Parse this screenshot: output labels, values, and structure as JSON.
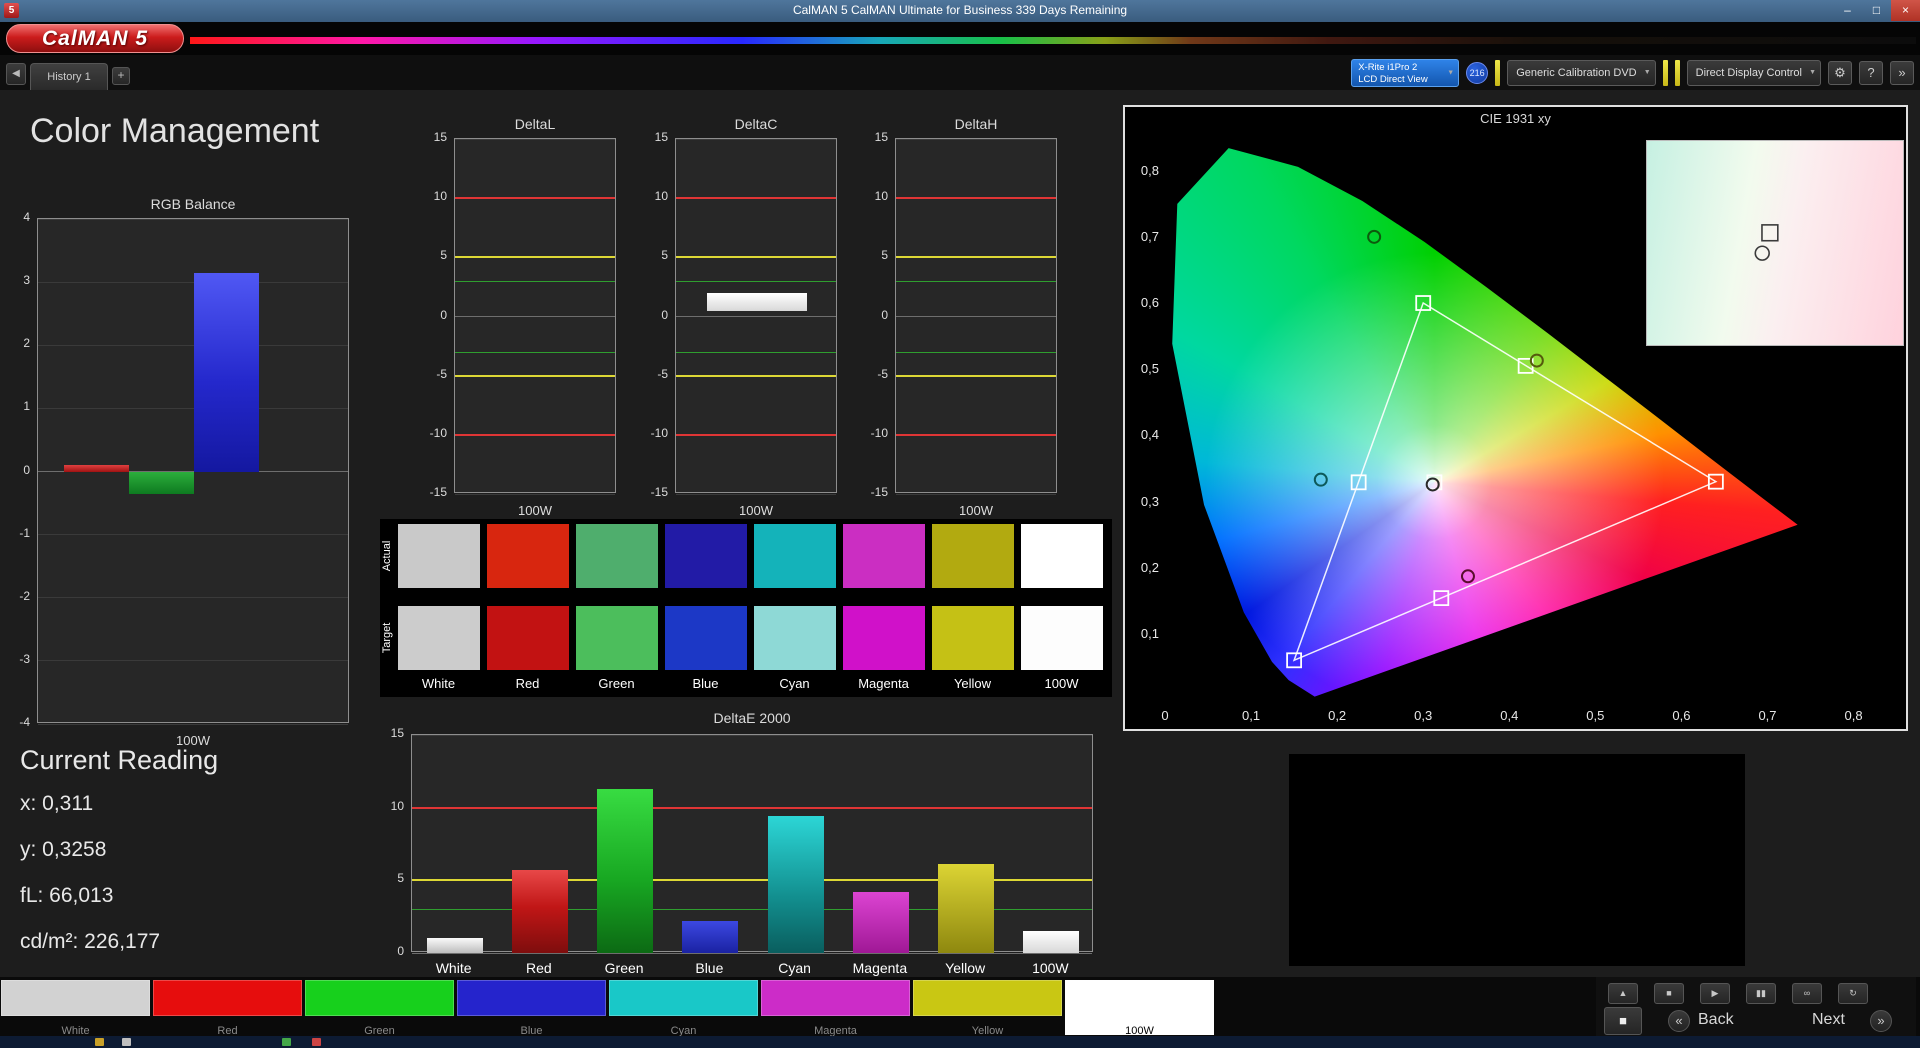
{
  "window": {
    "title": "CalMAN 5 CalMAN Ultimate for Business 339 Days Remaining",
    "app_icon": "5",
    "minimize": "–",
    "maximize": "□",
    "close": "×"
  },
  "branding": {
    "logo": "CalMAN 5"
  },
  "toolbar": {
    "nav_back": "◀",
    "history_tab": "History 1",
    "add_tab": "+",
    "meter_line1": "X-Rite i1Pro 2",
    "meter_line2": "LCD Direct View",
    "badge": "216",
    "source_dropdown": "Generic Calibration DVD",
    "display_dropdown": "Direct Display Control",
    "gear_icon": "⚙",
    "help_icon": "?",
    "expand_icon": "»",
    "caret": "▼"
  },
  "page_title": "Color Management",
  "current_reading": {
    "title": "Current Reading",
    "x": "x: 0,311",
    "y": "y: 0,3258",
    "fl": "fL: 66,013",
    "cd": "cd/m²: 226,177"
  },
  "swatch_grid": {
    "row_labels": [
      "Actual",
      "Target"
    ],
    "columns": [
      "White",
      "Red",
      "Green",
      "Blue",
      "Cyan",
      "Magenta",
      "Yellow",
      "100W"
    ],
    "actual_colors": [
      "#c9c9c9",
      "#d8260f",
      "#4fae6d",
      "#221ba6",
      "#14b3ba",
      "#cb2ec2",
      "#b2aa10",
      "#ffffff"
    ],
    "target_colors": [
      "#cccccc",
      "#c21212",
      "#4cbe5c",
      "#1c38c6",
      "#8ed9d6",
      "#d011c9",
      "#c5c115",
      "#fdfdfd"
    ]
  },
  "chart_data": [
    {
      "type": "bar",
      "title": "RGB Balance",
      "xlabel": "100W",
      "ylim": [
        -4,
        4
      ],
      "ticks": [
        4,
        3,
        2,
        1,
        0,
        -1,
        -2,
        -3,
        -4
      ],
      "categories": [
        "Red",
        "Green",
        "Blue"
      ],
      "values": [
        0.1,
        -0.35,
        3.15
      ],
      "bar_colors": [
        "rgb_red",
        "rgb_green",
        "rgb_blue"
      ]
    },
    {
      "type": "bar",
      "title": "DeltaL",
      "xlabel": "100W",
      "ylim": [
        -15,
        15
      ],
      "ticks": [
        15,
        10,
        5,
        0,
        -5,
        -10,
        -15
      ],
      "ref_lines": [
        {
          "y": 10,
          "color": "#e03535",
          "w": 2
        },
        {
          "y": -10,
          "color": "#e03535",
          "w": 2
        },
        {
          "y": 5,
          "color": "#ddd835",
          "w": 2
        },
        {
          "y": -5,
          "color": "#ddd835",
          "w": 2
        },
        {
          "y": 3,
          "color": "#2f9e2f",
          "w": 1
        },
        {
          "y": -3,
          "color": "#2f9e2f",
          "w": 1
        }
      ],
      "categories": [
        "100W"
      ],
      "values": [],
      "bar_colors": []
    },
    {
      "type": "bar",
      "title": "DeltaC",
      "xlabel": "100W",
      "ylim": [
        -15,
        15
      ],
      "ticks": [
        15,
        10,
        5,
        0,
        -5,
        -10,
        -15
      ],
      "ref_lines": [
        {
          "y": 10,
          "color": "#e03535",
          "w": 2
        },
        {
          "y": -10,
          "color": "#e03535",
          "w": 2
        },
        {
          "y": 5,
          "color": "#ddd835",
          "w": 2
        },
        {
          "y": -5,
          "color": "#ddd835",
          "w": 2
        },
        {
          "y": 3,
          "color": "#2f9e2f",
          "w": 1
        },
        {
          "y": -3,
          "color": "#2f9e2f",
          "w": 1
        }
      ],
      "categories": [
        "100W"
      ],
      "values": [
        1.95
      ],
      "bases": [
        0.45
      ],
      "bar_colors": [
        "plain_white"
      ]
    },
    {
      "type": "bar",
      "title": "DeltaH",
      "xlabel": "100W",
      "ylim": [
        -15,
        15
      ],
      "ticks": [
        15,
        10,
        5,
        0,
        -5,
        -10,
        -15
      ],
      "ref_lines": [
        {
          "y": 10,
          "color": "#e03535",
          "w": 2
        },
        {
          "y": -10,
          "color": "#e03535",
          "w": 2
        },
        {
          "y": 5,
          "color": "#ddd835",
          "w": 2
        },
        {
          "y": -5,
          "color": "#ddd835",
          "w": 2
        },
        {
          "y": 3,
          "color": "#2f9e2f",
          "w": 1
        },
        {
          "y": -3,
          "color": "#2f9e2f",
          "w": 1
        }
      ],
      "categories": [
        "100W"
      ],
      "values": [],
      "bar_colors": []
    },
    {
      "type": "bar",
      "title": "DeltaE 2000",
      "xlabel": "",
      "ylim": [
        0,
        15
      ],
      "ticks": [
        15,
        10,
        5,
        0
      ],
      "ref_lines": [
        {
          "y": 10,
          "color": "#e03535",
          "w": 2
        },
        {
          "y": 5,
          "color": "#ddd835",
          "w": 2
        },
        {
          "y": 3,
          "color": "#2f9e2f",
          "w": 1
        }
      ],
      "categories": [
        "White",
        "Red",
        "Green",
        "Blue",
        "Cyan",
        "Magenta",
        "Yellow",
        "100W"
      ],
      "values": [
        1.0,
        5.7,
        11.3,
        2.2,
        9.4,
        4.2,
        6.1,
        1.5
      ],
      "bar_colors": [
        "white",
        "red",
        "green",
        "blue",
        "cyan",
        "magenta",
        "yellow",
        "plain_white"
      ]
    },
    {
      "type": "scatter",
      "title": "CIE 1931 xy",
      "xlim": [
        0,
        0.84
      ],
      "ylim": [
        0,
        0.86
      ],
      "x_ticks": {
        "values": [
          0,
          0.1,
          0.2,
          0.3,
          0.4,
          0.5,
          0.6,
          0.7,
          0.8
        ],
        "labels": [
          "0",
          "0,1",
          "0,2",
          "0,3",
          "0,4",
          "0,5",
          "0,6",
          "0,7",
          "0,8"
        ]
      },
      "y_ticks": {
        "values": [
          0.1,
          0.2,
          0.3,
          0.4,
          0.5,
          0.6,
          0.7,
          0.8
        ],
        "labels": [
          "0,1",
          "0,2",
          "0,3",
          "0,4",
          "0,5",
          "0,6",
          "0,7",
          "0,8"
        ]
      },
      "gamut_triangle": [
        [
          0.64,
          0.33
        ],
        [
          0.3,
          0.6
        ],
        [
          0.15,
          0.06
        ]
      ],
      "targets": [
        [
          0.313,
          0.329
        ],
        [
          0.64,
          0.33
        ],
        [
          0.3,
          0.6
        ],
        [
          0.15,
          0.06
        ],
        [
          0.225,
          0.329
        ],
        [
          0.321,
          0.154
        ],
        [
          0.419,
          0.505
        ]
      ],
      "measurements": [
        {
          "x": 0.311,
          "y": 0.3258,
          "color": "#2a2a2a"
        },
        {
          "x": 0.243,
          "y": 0.7,
          "color": "#0d5a0d"
        },
        {
          "x": 0.181,
          "y": 0.333,
          "color": "#0d5a5a"
        },
        {
          "x": 0.432,
          "y": 0.513,
          "color": "#555a0d"
        },
        {
          "x": 0.352,
          "y": 0.187,
          "color": "#5a0d2d"
        }
      ],
      "inset_markers": {
        "square": [
          0.48,
          0.45
        ],
        "circle": [
          0.45,
          0.55
        ]
      }
    }
  ],
  "bottom_bar": {
    "buttons": [
      {
        "label": "White",
        "color": "#d2d2d2"
      },
      {
        "label": "Red",
        "color": "#e60d0d"
      },
      {
        "label": "Green",
        "color": "#17d01c"
      },
      {
        "label": "Blue",
        "color": "#2524cc"
      },
      {
        "label": "Cyan",
        "color": "#19c8c8"
      },
      {
        "label": "Magenta",
        "color": "#cc2cc8"
      },
      {
        "label": "Yellow",
        "color": "#c9c713"
      },
      {
        "label": "100W",
        "color": "#ffffff",
        "selected": true
      }
    ]
  },
  "transport": {
    "buttons": [
      {
        "name": "eject",
        "glyph": "▲"
      },
      {
        "name": "stop",
        "glyph": "■"
      },
      {
        "name": "play",
        "glyph": "▶"
      },
      {
        "name": "pause",
        "glyph": "▮▮"
      },
      {
        "name": "loop",
        "glyph": "∞"
      },
      {
        "name": "refresh",
        "glyph": "↻"
      }
    ],
    "pattern_button": "■",
    "prev_glyph": "«",
    "back_label": "Back",
    "next_label": "Next",
    "next_glyph": "»"
  }
}
